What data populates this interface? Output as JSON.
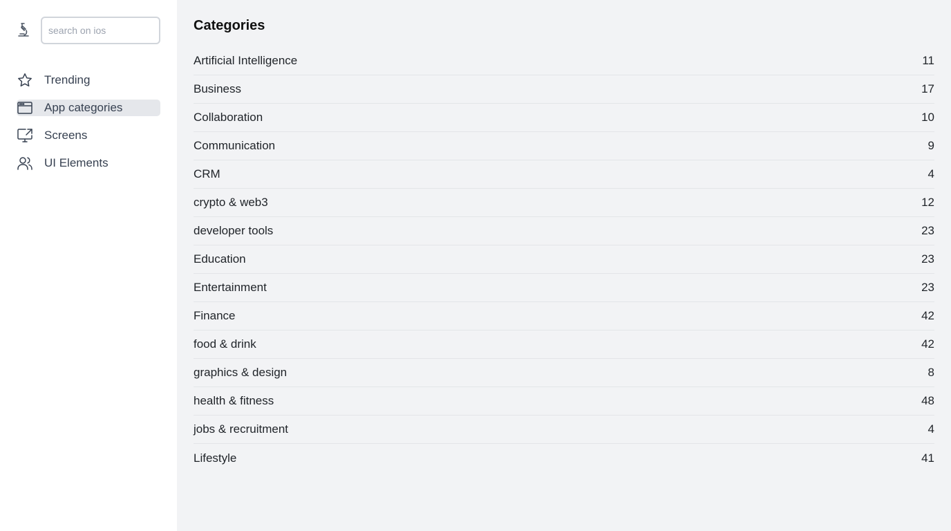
{
  "search": {
    "placeholder": "search on ios"
  },
  "sidebar": {
    "items": [
      {
        "label": "Trending",
        "icon": "star-icon"
      },
      {
        "label": "App categories",
        "icon": "browser-window-icon",
        "active": true
      },
      {
        "label": "Screens",
        "icon": "monitor-share-icon"
      },
      {
        "label": "UI Elements",
        "icon": "users-icon"
      }
    ]
  },
  "main": {
    "title": "Categories",
    "categories": [
      {
        "name": "Artificial Intelligence",
        "count": "11"
      },
      {
        "name": "Business",
        "count": "17"
      },
      {
        "name": "Collaboration",
        "count": "10"
      },
      {
        "name": "Communication",
        "count": "9"
      },
      {
        "name": "CRM",
        "count": "4"
      },
      {
        "name": "crypto & web3",
        "count": "12"
      },
      {
        "name": "developer tools",
        "count": "23"
      },
      {
        "name": "Education",
        "count": "23"
      },
      {
        "name": "Entertainment",
        "count": "23"
      },
      {
        "name": "Finance",
        "count": "42"
      },
      {
        "name": "food & drink",
        "count": "42"
      },
      {
        "name": "graphics & design",
        "count": "8"
      },
      {
        "name": "health & fitness",
        "count": "48"
      },
      {
        "name": "jobs & recruitment",
        "count": "4"
      },
      {
        "name": "Lifestyle",
        "count": "41"
      }
    ]
  },
  "colors": {
    "sidebar_bg": "#ffffff",
    "main_bg": "#f2f3f5",
    "active_item_bg": "#e5e7eb",
    "divider": "#e3e5e8"
  }
}
